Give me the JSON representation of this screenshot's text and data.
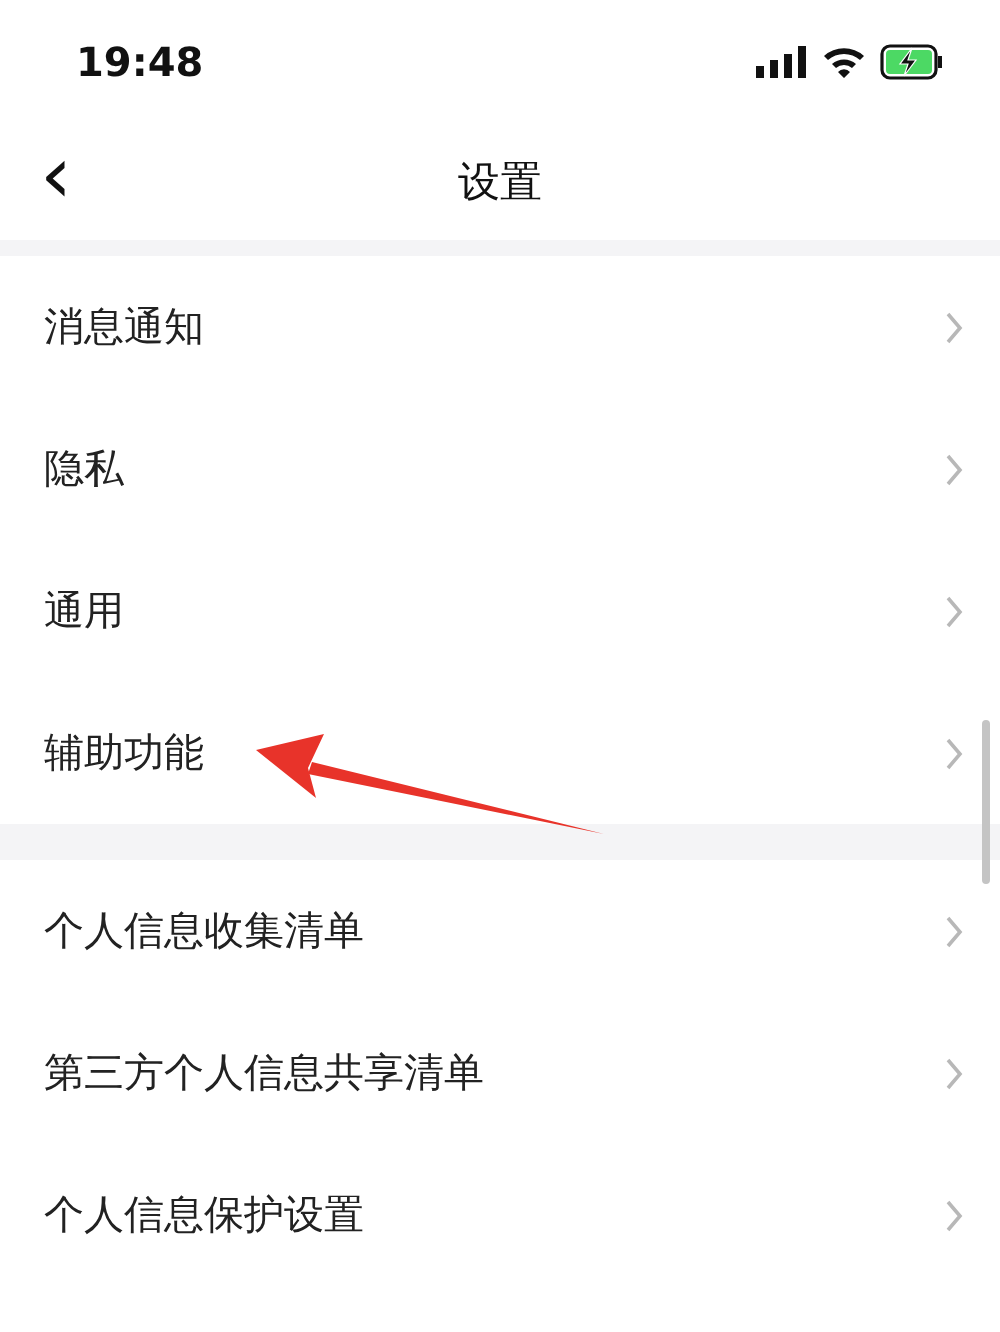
{
  "status_bar": {
    "time": "19:48",
    "charging": true
  },
  "nav_bar": {
    "back_icon": "‹",
    "title": "设置"
  },
  "sections": [
    {
      "items": [
        {
          "label": "消息通知",
          "highlighted": false
        },
        {
          "label": "隐私",
          "highlighted": false
        },
        {
          "label": "通用",
          "highlighted": false
        },
        {
          "label": "辅助功能",
          "highlighted": true
        }
      ]
    },
    {
      "items": [
        {
          "label": "个人信息收集清单",
          "highlighted": false
        },
        {
          "label": "第三方个人信息共享清单",
          "highlighted": false
        },
        {
          "label": "个人信息保护设置",
          "highlighted": false
        }
      ]
    }
  ]
}
